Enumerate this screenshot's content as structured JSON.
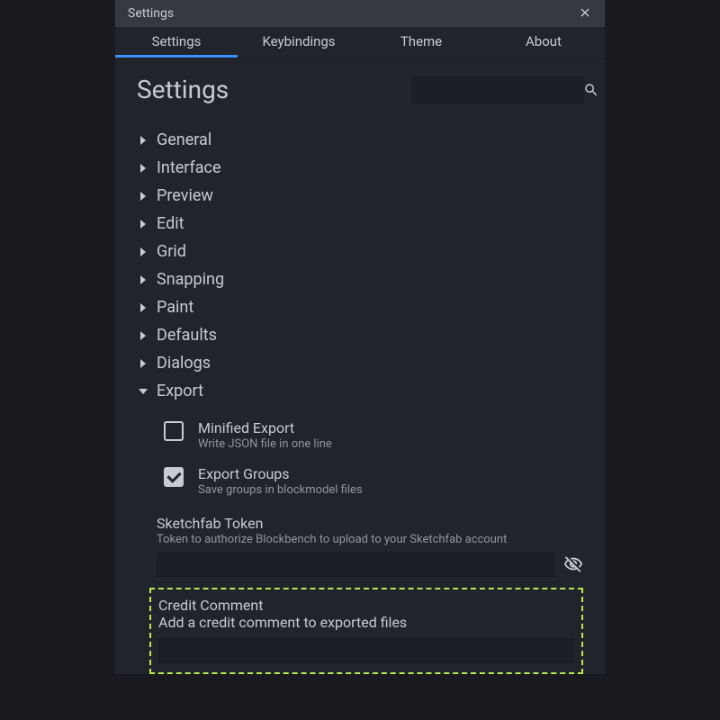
{
  "titlebar": {
    "title": "Settings"
  },
  "tabs": {
    "items": [
      {
        "label": "Settings"
      },
      {
        "label": "Keybindings"
      },
      {
        "label": "Theme"
      },
      {
        "label": "About"
      }
    ]
  },
  "header": {
    "page_title": "Settings"
  },
  "search": {
    "value": "",
    "placeholder": ""
  },
  "categories": [
    {
      "label": "General",
      "expanded": false
    },
    {
      "label": "Interface",
      "expanded": false
    },
    {
      "label": "Preview",
      "expanded": false
    },
    {
      "label": "Edit",
      "expanded": false
    },
    {
      "label": "Grid",
      "expanded": false
    },
    {
      "label": "Snapping",
      "expanded": false
    },
    {
      "label": "Paint",
      "expanded": false
    },
    {
      "label": "Defaults",
      "expanded": false
    },
    {
      "label": "Dialogs",
      "expanded": false
    },
    {
      "label": "Export",
      "expanded": true
    }
  ],
  "export": {
    "minified": {
      "title": "Minified Export",
      "desc": "Write JSON file in one line",
      "checked": false
    },
    "groups": {
      "title": "Export Groups",
      "desc": "Save groups in blockmodel files",
      "checked": true
    },
    "sketchfab": {
      "title": "Sketchfab Token",
      "desc": "Token to authorize Blockbench to upload to your Sketchfab account",
      "value": ""
    },
    "credit": {
      "title": "Credit Comment",
      "desc": "Add a credit comment to exported files",
      "value": ""
    }
  }
}
